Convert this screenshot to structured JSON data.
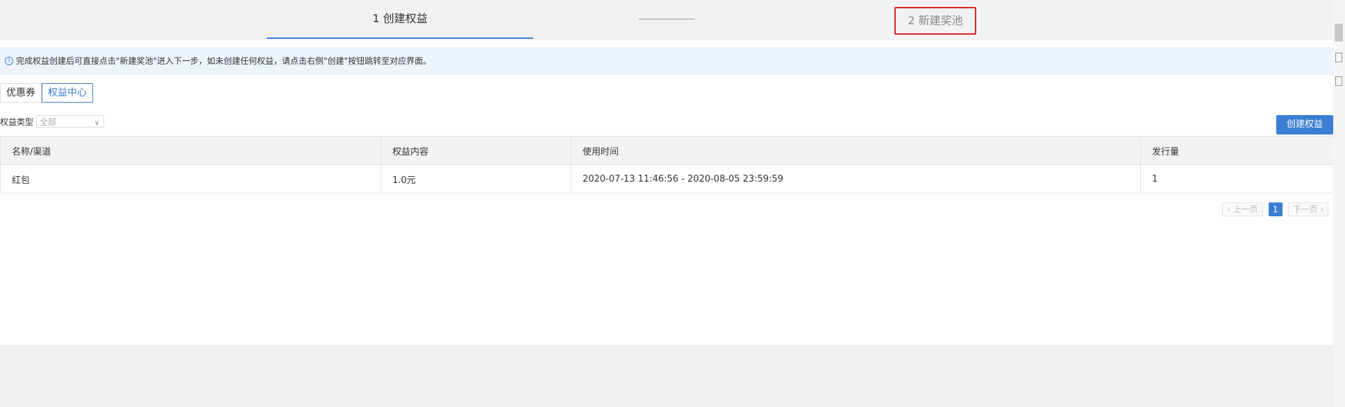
{
  "steps": {
    "step1": "1 创建权益",
    "step2": "2 新建奖池"
  },
  "notice": {
    "icon": "info-icon",
    "text": "完成权益创建后可直接点击\"新建奖池\"进入下一步，如未创建任何权益，请点击右侧\"创建\"按钮跳转至对应界面。"
  },
  "tabs": [
    "优惠券",
    "权益中心"
  ],
  "filter": {
    "label": "权益类型",
    "value": "全部"
  },
  "create_button": "创建权益",
  "table": {
    "headers": [
      "名称/渠道",
      "权益内容",
      "使用时间",
      "发行量"
    ],
    "rows": [
      [
        "红包",
        "1.0元",
        "2020-07-13 11:46:56 - 2020-08-05 23:59:59",
        "1"
      ]
    ]
  },
  "pager": {
    "prev": "上一页",
    "current": "1",
    "next": "下一页"
  },
  "colors": {
    "accent": "#3b7ed4",
    "highlight_border": "#e02020"
  }
}
